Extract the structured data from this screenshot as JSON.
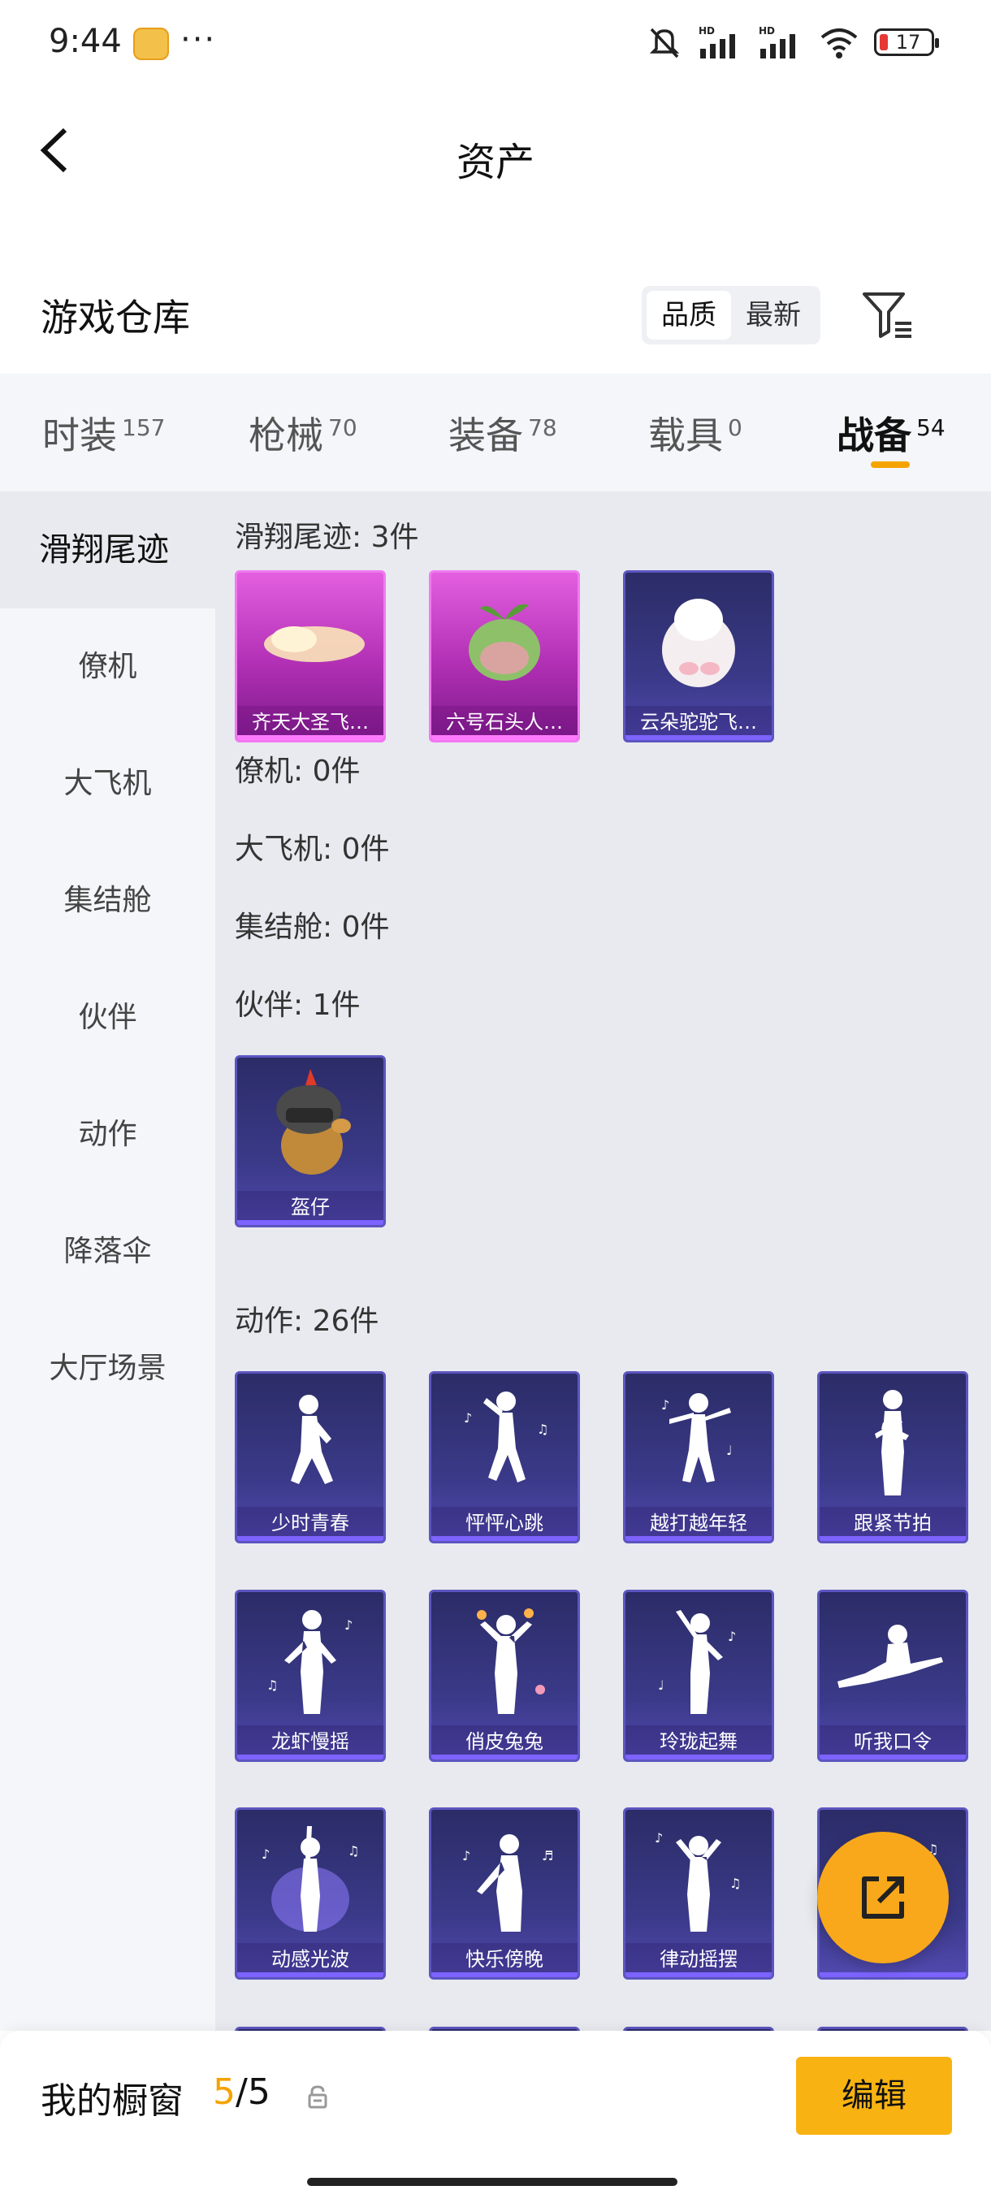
{
  "status_bar": {
    "time": "9:44",
    "dots": "···",
    "battery": "17"
  },
  "nav": {
    "title": "资产"
  },
  "warehouse": {
    "title": "游戏仓库",
    "sort_options": [
      "品质",
      "最新"
    ]
  },
  "tabs": [
    {
      "label": "时装",
      "count": "157"
    },
    {
      "label": "枪械",
      "count": "70"
    },
    {
      "label": "装备",
      "count": "78"
    },
    {
      "label": "载具",
      "count": "0"
    },
    {
      "label": "战备",
      "count": "54"
    }
  ],
  "sidebar": [
    "滑翔尾迹",
    "僚机",
    "大飞机",
    "集结舱",
    "伙伴",
    "动作",
    "降落伞",
    "大厅场景"
  ],
  "sections": {
    "glide": {
      "title": "滑翔尾迹: 3件",
      "items": [
        "齐天大圣飞…",
        "六号石头人…",
        "云朵驼驼飞…"
      ]
    },
    "wingman": {
      "title": "僚机: 0件"
    },
    "plane": {
      "title": "大飞机: 0件"
    },
    "pod": {
      "title": "集结舱: 0件"
    },
    "partner": {
      "title": "伙伴: 1件",
      "items": [
        "盔仔"
      ]
    },
    "emote": {
      "title": "动作: 26件",
      "items": [
        "少时青春",
        "怦怦心跳",
        "越打越年轻",
        "跟紧节拍",
        "龙虾慢摇",
        "俏皮兔兔",
        "玲珑起舞",
        "听我口令",
        "动感光波",
        "快乐傍晚",
        "律动摇摆"
      ]
    }
  },
  "bottom": {
    "label": "我的橱窗",
    "current": "5",
    "total": "/5",
    "edit_label": "编辑"
  }
}
